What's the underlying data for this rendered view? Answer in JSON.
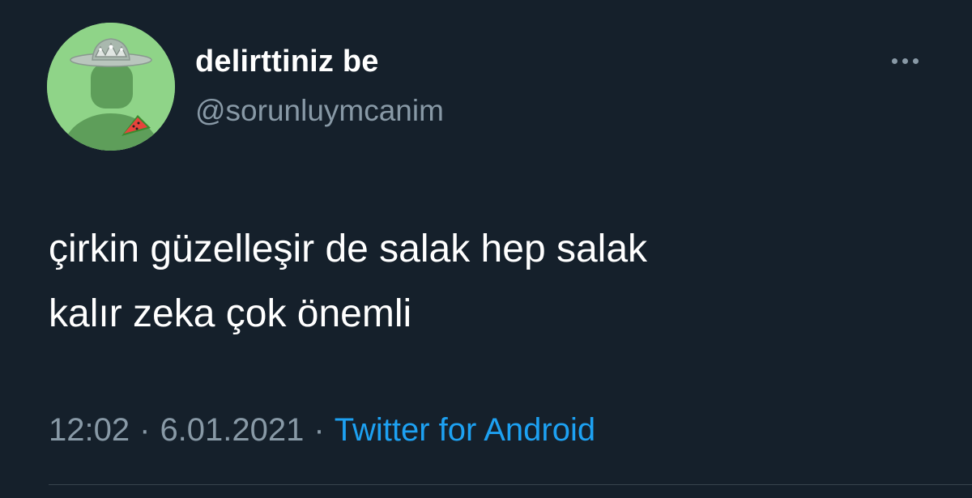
{
  "tweet": {
    "author": {
      "display_name": "delirttiniz be",
      "handle": "@sorunluymcanim",
      "avatar_icon": "default-profile-with-crown-hat-and-watermelon-icon"
    },
    "more_icon": "more-options-icon",
    "text": "çirkin güzelleşir de salak hep salak\nkalır zeka çok önemli",
    "time": "12:02",
    "separator": "·",
    "date": "6.01.2021",
    "source": "Twitter for Android"
  },
  "colors": {
    "background": "#15202b",
    "primary_text": "#ffffff",
    "secondary_text": "#8899a6",
    "link": "#1da1f2",
    "avatar_bg": "#8fd488",
    "divider": "#38444d"
  }
}
